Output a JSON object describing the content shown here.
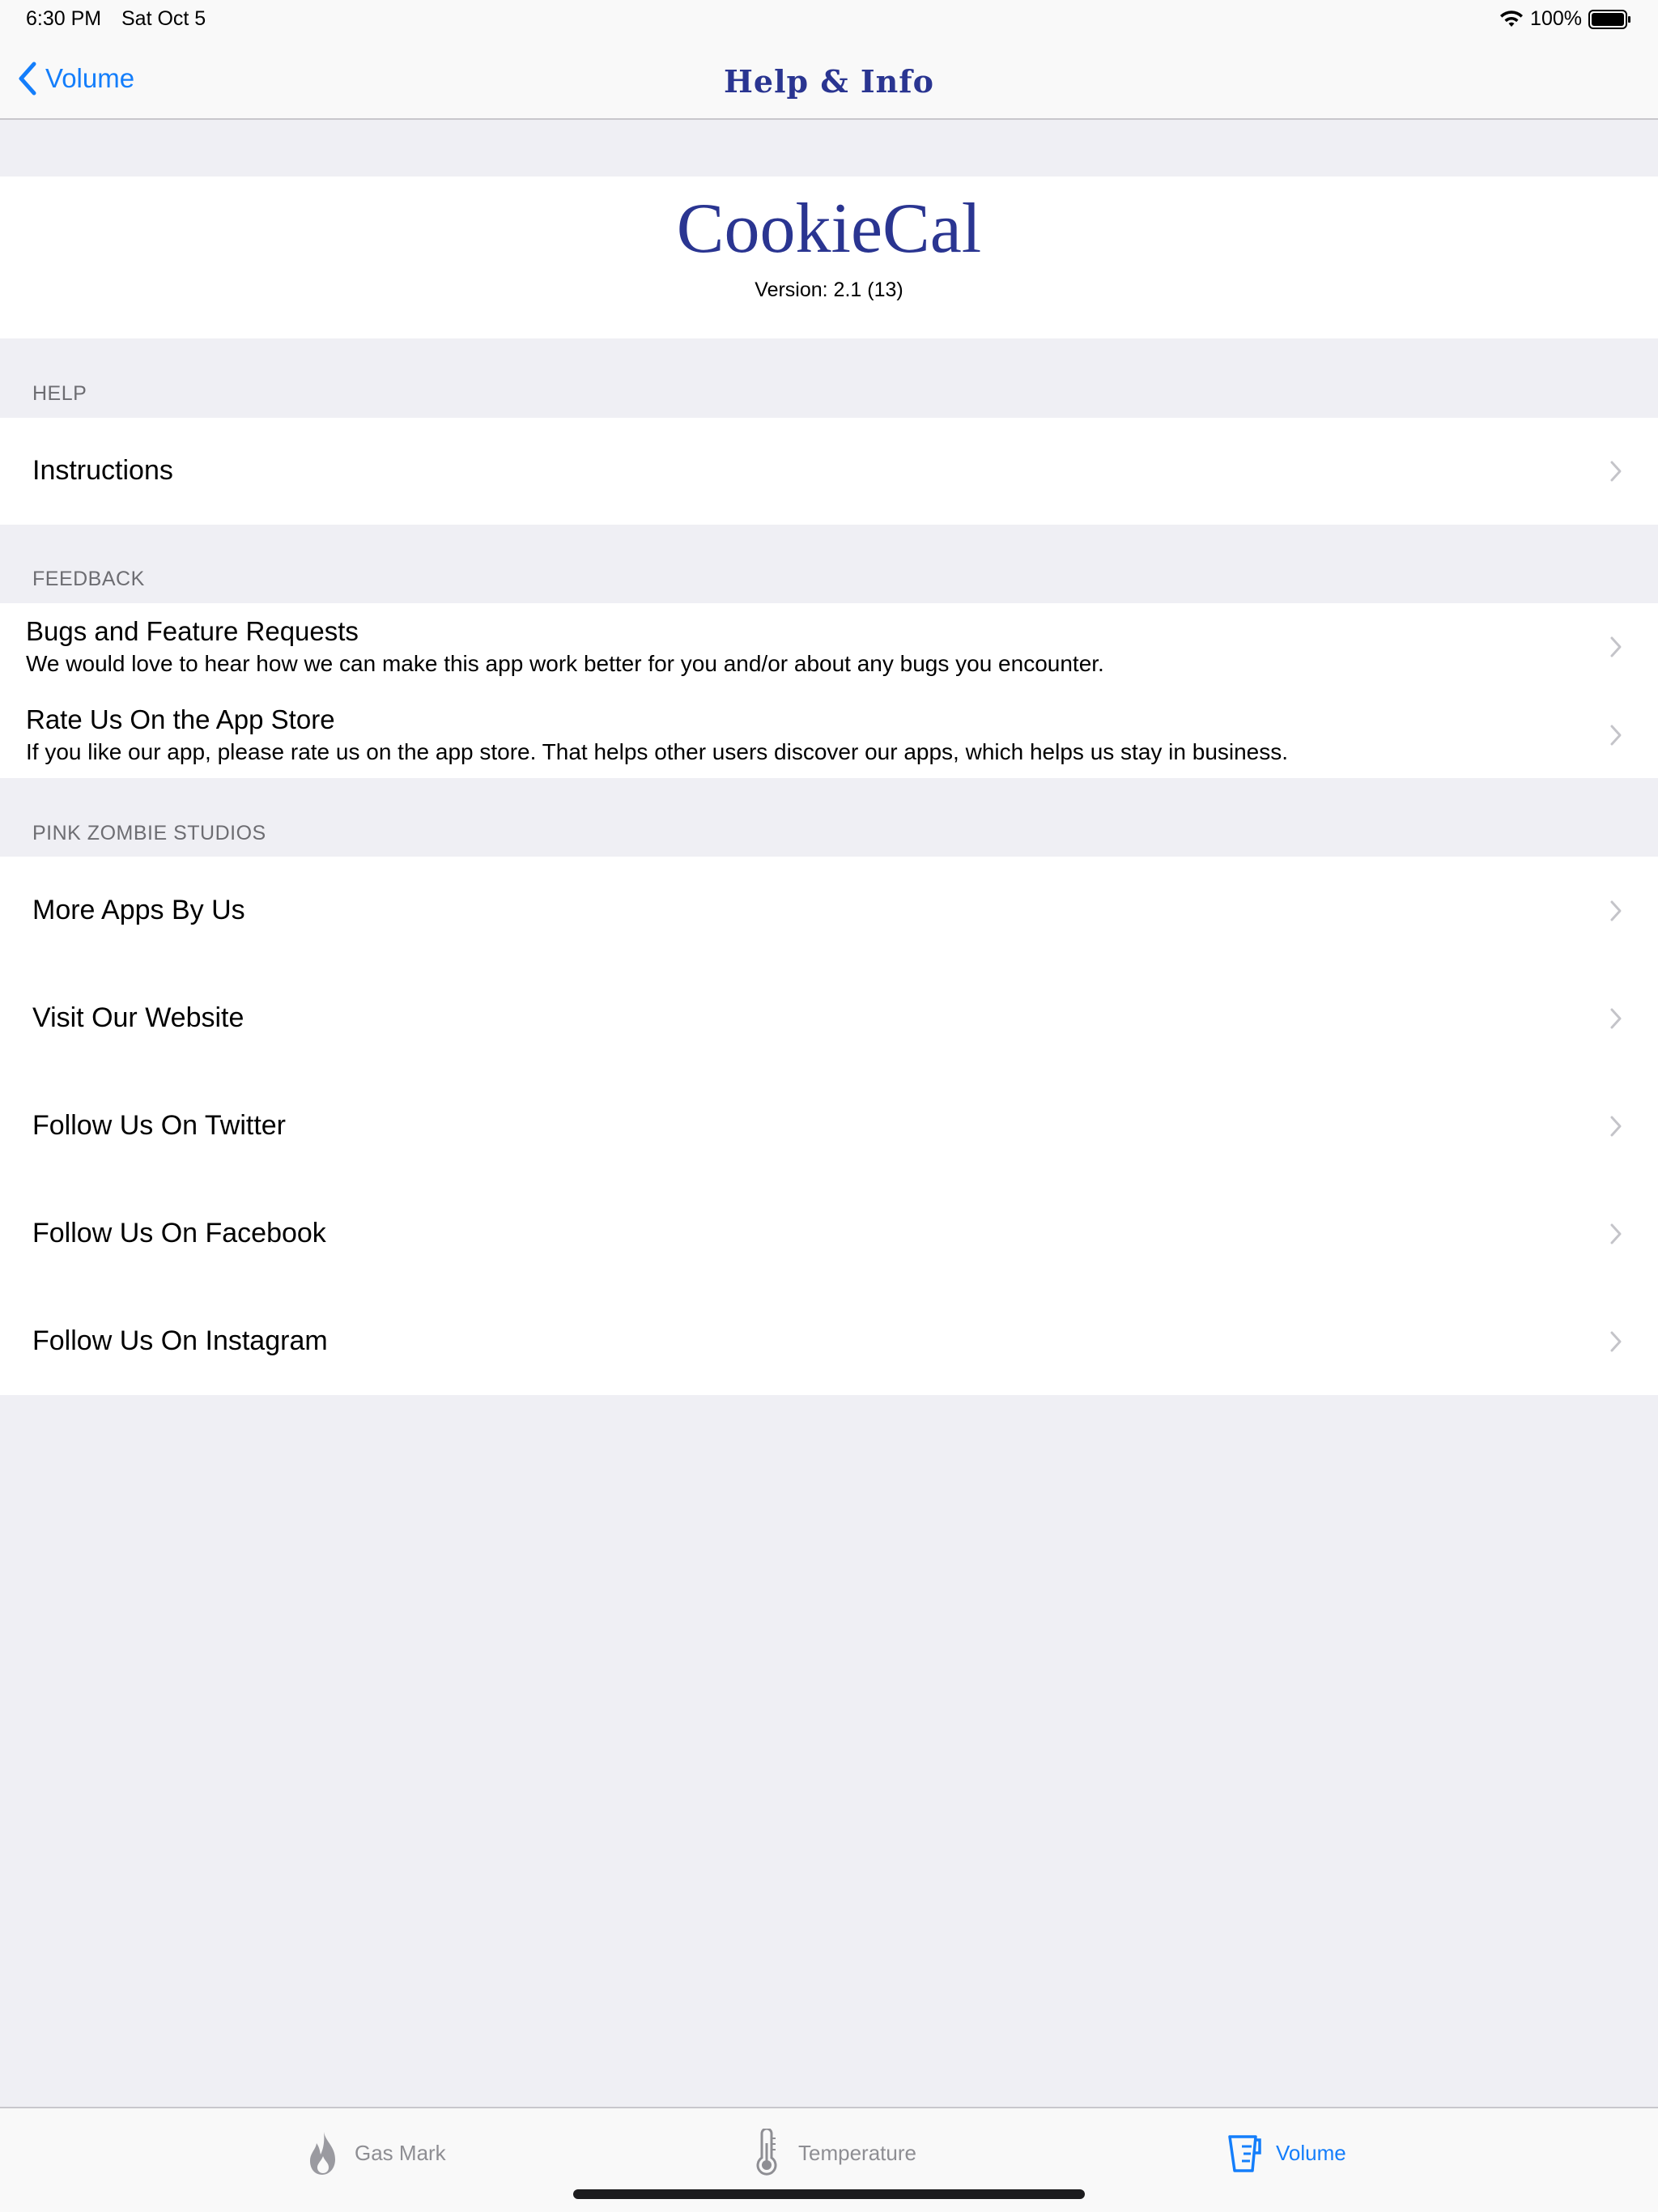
{
  "status_bar": {
    "time": "6:30 PM",
    "date": "Sat Oct 5",
    "battery": "100%"
  },
  "nav": {
    "back_label": "Volume",
    "title": "Help & Info"
  },
  "header": {
    "app_name": "CookieCal",
    "version": "Version: 2.1 (13)"
  },
  "sections": {
    "help": {
      "title": "HELP",
      "items": [
        {
          "label": "Instructions"
        }
      ]
    },
    "feedback": {
      "title": "FEEDBACK",
      "items": [
        {
          "label": "Bugs and Feature Requests",
          "description": "We would love to hear how we can make this app work better for you and/or about any bugs you encounter."
        },
        {
          "label": "Rate Us On the App Store",
          "description": "If you like our app, please rate us on the app store. That helps other users discover our apps, which helps us stay in business."
        }
      ]
    },
    "studio": {
      "title": "PINK ZOMBIE STUDIOS",
      "items": [
        {
          "label": "More Apps By Us"
        },
        {
          "label": "Visit Our Website"
        },
        {
          "label": "Follow Us On Twitter"
        },
        {
          "label": "Follow Us On Facebook"
        },
        {
          "label": "Follow Us On Instagram"
        }
      ]
    }
  },
  "tabs": [
    {
      "label": "Gas Mark",
      "icon": "flame-icon",
      "selected": false
    },
    {
      "label": "Temperature",
      "icon": "thermometer-icon",
      "selected": false
    },
    {
      "label": "Volume",
      "icon": "measuring-cup-icon",
      "selected": true
    }
  ],
  "colors": {
    "accent": "#147efb",
    "title_navy": "#2a3591",
    "tab_inactive": "#8e8e93",
    "background": "#efeff4",
    "section_text": "#6d6d72"
  }
}
